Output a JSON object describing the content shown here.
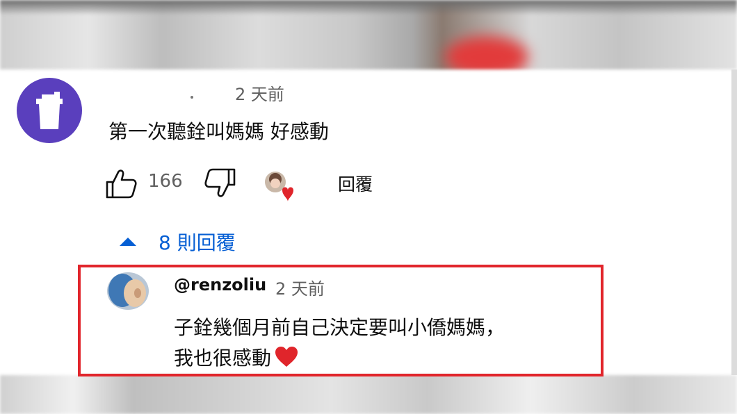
{
  "comment": {
    "avatar_icon": "cup-icon",
    "time": "2 天前",
    "text": "第一次聽銓叫媽媽 好感動",
    "like_count": "166",
    "reply_label": "回覆",
    "icons": {
      "like": "thumbs-up-icon",
      "dislike": "thumbs-down-icon",
      "creator_heart": "creator-heart-icon"
    }
  },
  "replies_toggle": {
    "label": "8 則回覆",
    "icon": "caret-up-icon"
  },
  "reply": {
    "author": "@renzoliu",
    "time": "2 天前",
    "text_line1": "子銓幾個月前自己決定要叫小僑媽媽，",
    "text_line2": "我也很感動",
    "heart_icon": "red-heart-icon"
  },
  "colors": {
    "link_blue": "#065fd4",
    "avatar_purple": "#5a3fbd",
    "highlight_red": "#e1252b",
    "heart_red": "#e0252b",
    "secondary_text": "#606060"
  }
}
